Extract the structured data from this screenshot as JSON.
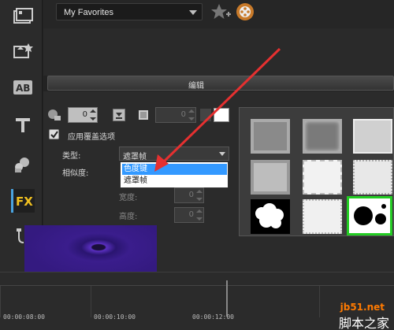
{
  "topbar": {
    "favorites_label": "My Favorites"
  },
  "panel": {
    "header_label": "编辑"
  },
  "overlay": {
    "size_value": "0",
    "border_value": "0",
    "apply_overlay_label": "应用覆盖选项",
    "type_label": "类型:",
    "type_value": "遮罩帧",
    "similarity_label": "相似度:",
    "width_label": "宽度:",
    "width_value": "0",
    "height_label": "高度:",
    "height_value": "0",
    "type_options": [
      "色度键",
      "遮罩帧"
    ]
  },
  "timeline": {
    "timecodes": [
      "00:00:08:00",
      "00:00:10:00",
      "00:00:12:00"
    ]
  },
  "watermark": {
    "site": "jb51.net",
    "name": "脚本之家"
  },
  "colors": {
    "accent": "#4aa3e0",
    "selection": "#3399ff",
    "arrow": "#e53030",
    "mask_highlight": "#22cc22"
  }
}
